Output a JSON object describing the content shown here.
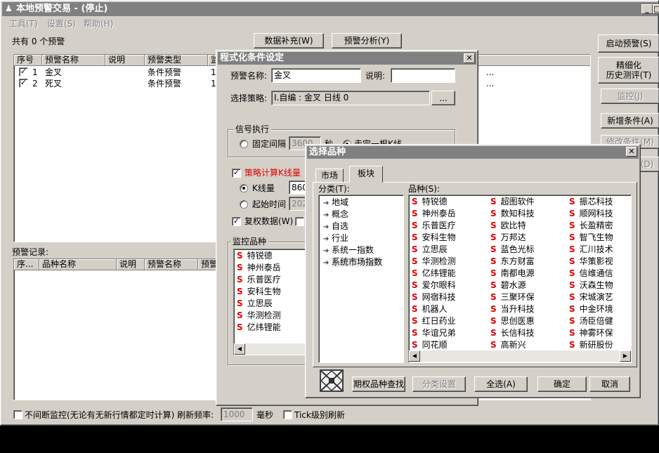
{
  "main": {
    "title": "本地预警交易 - (停止)",
    "menu": [
      "工具(T)",
      "设置(S)",
      "帮助(H)"
    ],
    "count_text": "共有 0 个预警",
    "btn_supplement": "数据补充(W)",
    "btn_analysis": "预警分析(Y)",
    "right_buttons": [
      "启动预警(S)",
      "精细化",
      "历史测评(T)",
      "监控(J)",
      "新增条件(A)",
      "修改条件(M)",
      "删除条件(D)"
    ],
    "columns": [
      "序号",
      "预警名称",
      "说明",
      "预警类型",
      "监"
    ],
    "rows": [
      {
        "no": "1",
        "name": "金叉",
        "desc": "",
        "type": "条件预警",
        "mon": "10"
      },
      {
        "no": "2",
        "name": "死叉",
        "desc": "",
        "type": "条件预警",
        "mon": "10"
      }
    ],
    "row_tail": "...",
    "record_label": "预警记录:",
    "record_columns": [
      "序...",
      "品种名称",
      "说明",
      "预警名称",
      "预警"
    ],
    "footer_check": "不间断监控(无论有无新行情都定时计算) 刷新频率:",
    "footer_freq": "1000",
    "footer_unit": "毫秒",
    "footer_tick": "Tick级别刷新"
  },
  "cond": {
    "title": "程式化条件设定",
    "name_label": "预警名称:",
    "name_value": "金叉",
    "desc_label": "说明:",
    "desc_value": "",
    "strategy_label": "选择策略:",
    "strategy_value": "I.自编 : 金叉 日线 0",
    "strategy_btn": "...",
    "signal_group": "信号执行",
    "fixed_interval": "固定间隔",
    "interval_value": "3600",
    "sec_label": "秒",
    "fixed_tail": "走完一根K线",
    "calc_label": "策略计算K线量",
    "kline_label": "K线量",
    "kline_value": "860",
    "start_label": "起始时间",
    "start_value": "2020",
    "restore_label": "复权数据(W)",
    "monitor_group": "监控品种",
    "monitor_items": [
      "特锐德",
      "神州泰岳",
      "乐普医疗",
      "安科生物",
      "立思辰",
      "华测检测",
      "亿纬锂能"
    ]
  },
  "select": {
    "title": "选择品种",
    "tabs": [
      "市场",
      "板块"
    ],
    "category_label": "分类(T):",
    "categories": [
      "地域",
      "概念",
      "自选",
      "行业",
      "系统一指数",
      "系统市场指数"
    ],
    "stock_label": "品种(S):",
    "stocks": [
      [
        "特锐德",
        "神州泰岳",
        "乐普医疗",
        "安科生物",
        "立思辰",
        "华测检测",
        "亿纬锂能",
        "爱尔眼科",
        "网宿科技",
        "机器人",
        "红日药业",
        "华谊兄弟",
        "同花顺"
      ],
      [
        "超图软件",
        "数知科技",
        "欧比特",
        "万邦达",
        "蓝色光标",
        "东方财富",
        "南都电源",
        "碧水源",
        "三聚环保",
        "当升科技",
        "思创医惠",
        "长信科技",
        "高新兴"
      ],
      [
        "振芯科技",
        "顺网科技",
        "长盈精密",
        "智飞生物",
        "汇川技术",
        "华策影视",
        "信维通信",
        "沃森生物",
        "宋城演艺",
        "中金环境",
        "汤臣倍健",
        "神雾环保",
        "新研股份"
      ]
    ],
    "btn_option_search": "期权品种查找",
    "btn_category_setting": "分类设置",
    "btn_select_all": "全选(A)",
    "btn_ok": "确定",
    "btn_cancel": "取消"
  }
}
